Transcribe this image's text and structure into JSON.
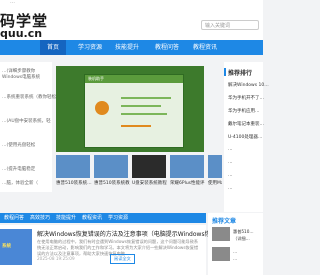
{
  "topbar": {
    "text": "…"
  },
  "header": {
    "logo_cn": "码学堂",
    "logo_url": "quu.cn",
    "search_placeholder": "输入关键词"
  },
  "nav": {
    "items": [
      "首页",
      "学习资源",
      "技能提升",
      "教程问答",
      "教程资讯"
    ]
  },
  "left_list": [
    "…(详细步骤教你",
    "Windows电脑系统",
    "…系统重装系统（教你轻松",
    "…(AU盘中安装系统，轻",
    "…(使用光盘轻松",
    "…(提升电脑稳定",
    "…脑，体验全新（"
  ],
  "banner": {
    "window_title": "装机助手",
    "colors": {
      "bg": "#3d7a2c"
    }
  },
  "thumbs": [
    {
      "caption": "惠普510装系统…",
      "style": "blue"
    },
    {
      "caption": "惠普510装系统教…",
      "style": "blue"
    },
    {
      "caption": "U盘安装系统教程",
      "style": "black"
    },
    {
      "caption": "荣耀6Plus性能评",
      "style": "blue"
    },
    {
      "caption": "使用Ma",
      "style": "blue"
    }
  ],
  "right_col": {
    "header": "推荐排行",
    "items": [
      "解决Windows 10…",
      "华为手机开不了…",
      "华为手机应用…",
      "戴尔笔记本重装…",
      "U-4100处理器…",
      "…",
      "…",
      "…",
      "…"
    ]
  },
  "tabs": [
    "教程问答",
    "高效技巧",
    "技能提升",
    "教程资讯",
    "学习资源"
  ],
  "article": {
    "thumb_label": "系统",
    "title": "解决Windows恢复错误的方法及注意事项（电脑提示Windows恢复错",
    "desc": "在使用电脑的过程中，我们有时会遇到Windows恢复错误的问题，这个问题可能导致系统无法正常启动，影响我们的工作和学习。本文将为大家介绍一些解决Windows恢复错误的方法以及注意事项，帮助大家快速恢复电脑…",
    "date": "2025-08 19:25:09",
    "btn": "阅读全文"
  },
  "right_box2": {
    "header": "推荐文章",
    "items": [
      "惠普510…",
      "（详细…",
      "…",
      "…"
    ]
  }
}
